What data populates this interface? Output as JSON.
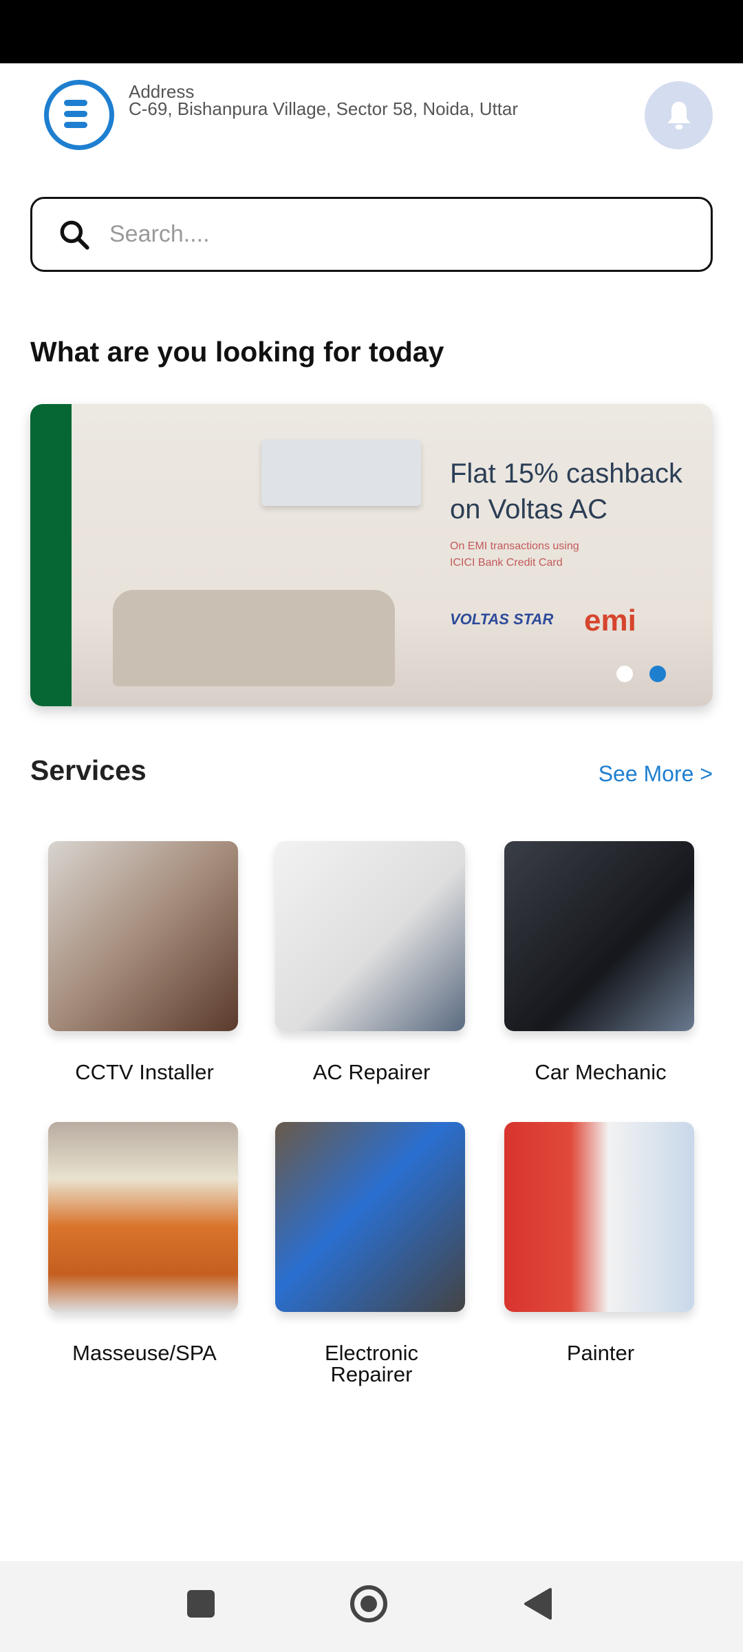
{
  "header": {
    "address_label": "Address",
    "address_value": "C-69, Bishanpura Village, Sector 58, Noida, Uttar",
    "menu_icon": "menu-icon",
    "notification_icon": "bell-icon"
  },
  "search": {
    "placeholder": "Search...."
  },
  "main": {
    "heading": "What are you looking for today"
  },
  "banner": {
    "headline": "Flat 15% cashback on Voltas AC",
    "subtext": "On EMI transactions using ICICI Bank Credit Card",
    "brand": "VOLTAS STAR",
    "brand2": "emi",
    "slide_count": 2,
    "active_slide": 2,
    "active_color": "#1e7fd0"
  },
  "services": {
    "title": "Services",
    "see_more": "See More >",
    "items": [
      {
        "label": "CCTV Installer"
      },
      {
        "label": "AC Repairer"
      },
      {
        "label": "Car Mechanic"
      },
      {
        "label": "Masseuse/SPA"
      },
      {
        "label": "Electronic Repairer"
      },
      {
        "label": "Painter"
      }
    ]
  },
  "colors": {
    "accent": "#1e7fd0",
    "bell_bg": "#d4dcef"
  }
}
